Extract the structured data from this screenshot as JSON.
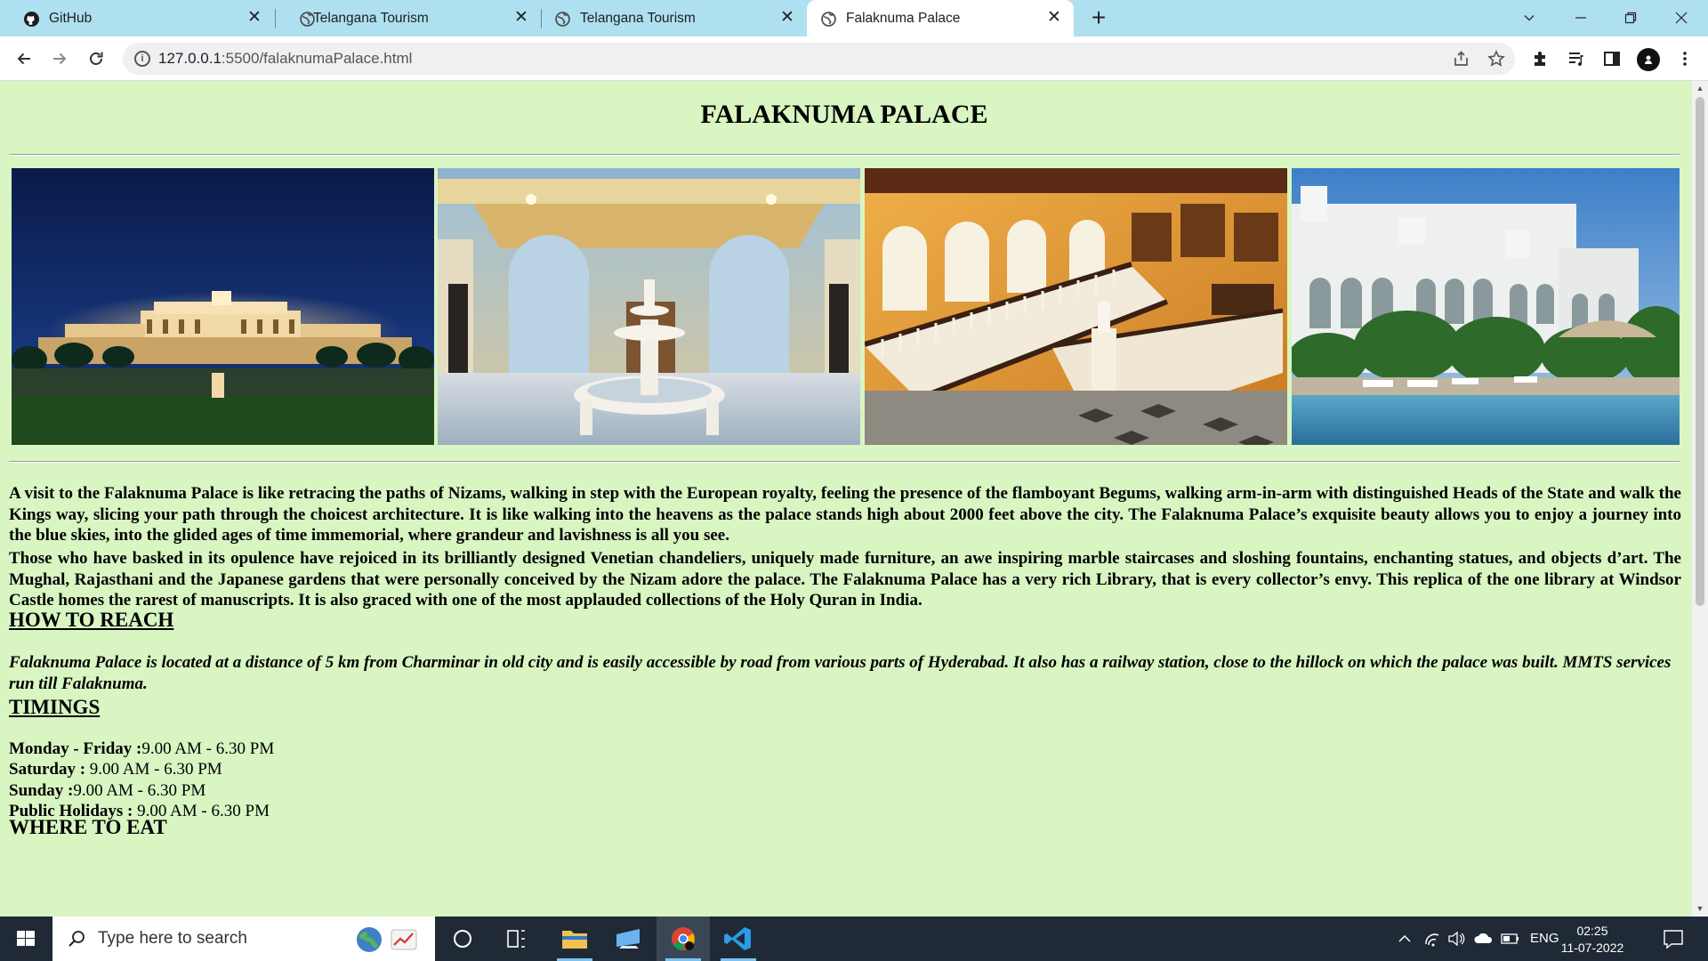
{
  "browser": {
    "tabs": [
      {
        "title": "GitHub",
        "icon": "github-icon"
      },
      {
        "title": "Telangana Tourism",
        "icon": "globe-icon"
      },
      {
        "title": "Telangana Tourism",
        "icon": "globe-icon"
      },
      {
        "title": "Falaknuma Palace",
        "icon": "globe-icon",
        "active": true
      }
    ],
    "url_host": "127.0.0.1",
    "url_rest": ":5500/falaknumaPalace.html"
  },
  "page": {
    "title": "FALAKNUMA PALACE",
    "photos": [
      {
        "subject": "palace illuminated at night"
      },
      {
        "subject": "fountain hall interior"
      },
      {
        "subject": "grand staircase interior"
      },
      {
        "subject": "palace facade with pool"
      }
    ],
    "intro": "A visit to the Falaknuma Palace is like retracing the paths of Nizams, walking in step with the European royalty, feeling the presence of the flamboyant Begums, walking arm-in-arm with distinguished Heads of the State and walk the Kings way, slicing your path through the choicest architecture. It is like walking into the heavens as the palace stands high about 2000 feet above the city. The Falaknuma Palace’s exquisite beauty allows you to enjoy a journey into the blue skies, into the glided ages of time immemorial, where grandeur and lavishness is all you see.",
    "opulence": "Those who have basked in its opulence have rejoiced in its brilliantly designed Venetian chandeliers, uniquely made furniture, an awe inspiring marble staircases and sloshing fountains, enchanting statues, and objects d’art. The Mughal, Rajasthani and the Japanese gardens that were personally conceived by the Nizam adore the palace. The Falaknuma Palace has a very rich Library, that is every collector’s envy. This replica of the one library at Windsor Castle homes the rarest of manuscripts. It is also graced with one of the most applauded collections of the Holy Quran in India.",
    "how_to_reach_heading": "HOW TO REACH",
    "how_to_reach": "Falaknuma Palace is located at a distance of 5 km from Charminar in old city and is easily accessible by road from various parts of Hyderabad. It also has a railway station, close to the hillock on which the palace was built. MMTS services run till Falaknuma.",
    "timings_heading": "TIMINGS",
    "timings": [
      {
        "day": "Monday - Friday :",
        "hours": "9.00 AM - 6.30 PM"
      },
      {
        "day": "Saturday :",
        "hours": " 9.00 AM - 6.30 PM"
      },
      {
        "day": "Sunday :",
        "hours": "9.00 AM - 6.30 PM"
      },
      {
        "day": "Public Holidays :",
        "hours": " 9.00 AM - 6.30 PM"
      }
    ],
    "where_to_eat_heading": "WHERE TO EAT"
  },
  "taskbar": {
    "search_placeholder": "Type here to search",
    "language": "ENG",
    "time": "02:25",
    "date": "11-07-2022"
  }
}
